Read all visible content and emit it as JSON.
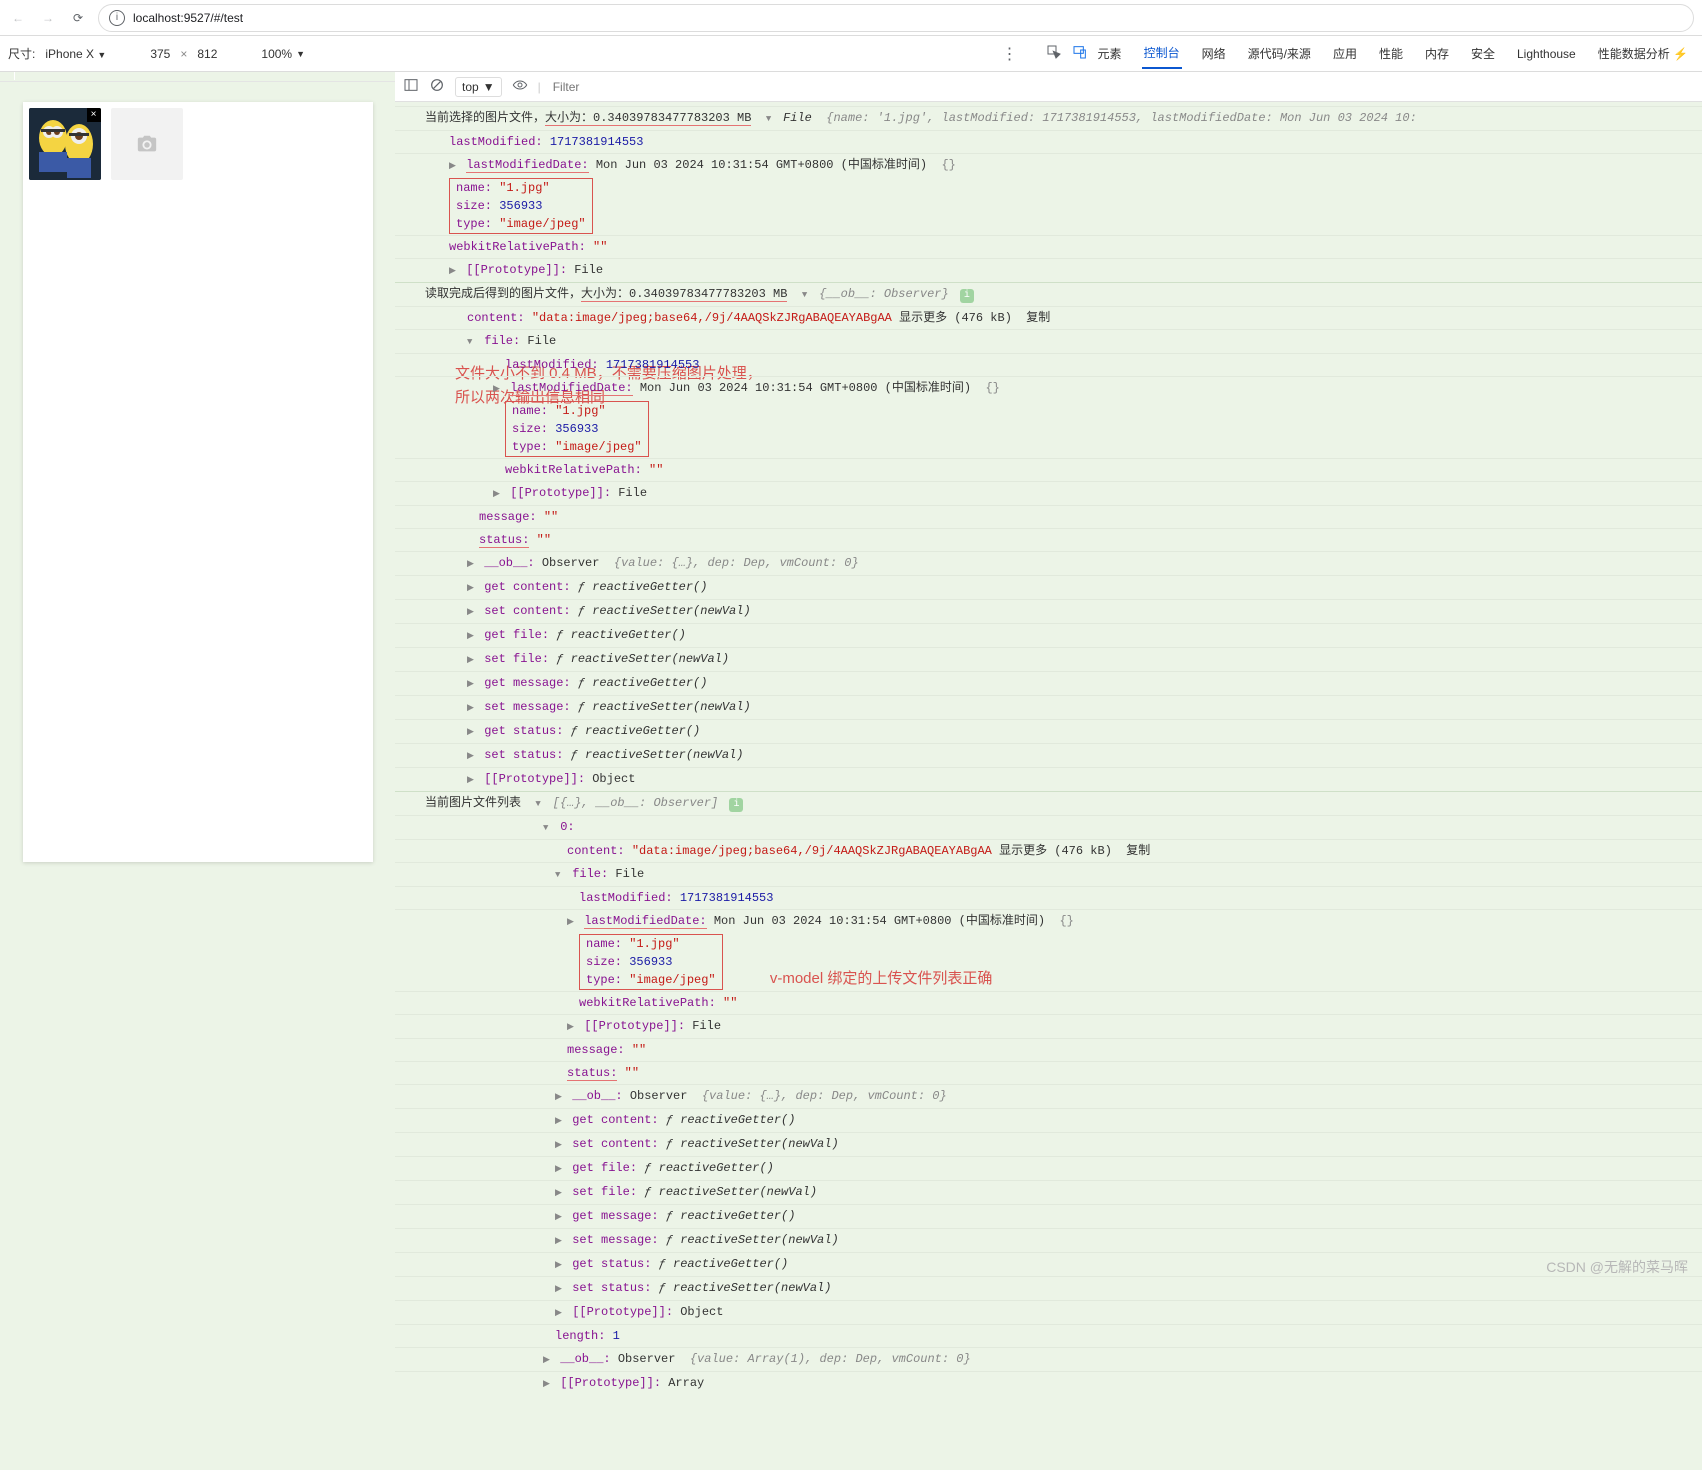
{
  "browser": {
    "url": "localhost:9527/#/test",
    "back_enabled": false,
    "forward_enabled": false
  },
  "device_toolbar": {
    "label": "尺寸:",
    "device": "iPhone X",
    "width": "375",
    "sep": "×",
    "height": "812",
    "zoom": "100%"
  },
  "devtools_tabs": {
    "elements": "元素",
    "console": "控制台",
    "network": "网络",
    "sources": "源代码/来源",
    "application": "应用",
    "performance": "性能",
    "memory": "内存",
    "security": "安全",
    "lighthouse": "Lighthouse",
    "perf_insights": "性能数据分析 ⚡"
  },
  "console_bar": {
    "context": "top",
    "filter_placeholder": "Filter"
  },
  "annotations": {
    "a1": "文件大小不到 0.4 MB，不需要压缩图片处理，所以两次输出信息相同",
    "a2": "v-model 绑定的上传文件列表正确"
  },
  "log1": {
    "prefix": "当前选择的图片文件，",
    "size_label": "大小为：0.34039783477783203 MB",
    "type": "File",
    "inline": "{name: '1.jpg', lastModified: 1717381914553, lastModifiedDate: Mon Jun 03 2024 10:",
    "lastModified_k": "lastModified:",
    "lastModified_v": "1717381914553",
    "lmd_k": "lastModifiedDate:",
    "lmd_v": "Mon Jun 03 2024 10:31:54 GMT+0800 (中国标准时间)",
    "lmd_tail": "{}",
    "name_k": "name:",
    "name_v": "\"1.jpg\"",
    "size_k": "size:",
    "size_v": "356933",
    "type_k": "type:",
    "type_v": "\"image/jpeg\"",
    "wrp_k": "webkitRelativePath:",
    "wrp_v": "\"\"",
    "proto_k": "[[Prototype]]:",
    "proto_v": "File"
  },
  "log2": {
    "prefix": "读取完成后得到的图片文件，",
    "size_label": "大小为：0.34039783477783203 MB",
    "obj": "{__ob__: Observer}",
    "content_k": "content:",
    "content_v": "\"data:image/jpeg;base64,/9j/4AAQSkZJRgABAQEAYABgAA",
    "content_more": "显示更多 (476 kB)",
    "content_copy": "复制",
    "file_k": "file:",
    "file_v": "File",
    "lastModified_k": "lastModified:",
    "lastModified_v": "1717381914553",
    "lmd_k": "lastModifiedDate:",
    "lmd_v": "Mon Jun 03 2024 10:31:54 GMT+0800 (中国标准时间)",
    "lmd_tail": "{}",
    "name_k": "name:",
    "name_v": "\"1.jpg\"",
    "size_k": "size:",
    "size_v": "356933",
    "type_k": "type:",
    "type_v": "\"image/jpeg\"",
    "wrp_k": "webkitRelativePath:",
    "wrp_v": "\"\"",
    "proto_k": "[[Prototype]]:",
    "proto_v": "File",
    "message_k": "message:",
    "message_v": "\"\"",
    "status_k": "status:",
    "status_v": "\"\"",
    "ob_k": "__ob__:",
    "ob_v": "Observer",
    "ob_detail": "{value: {…}, dep: Dep, vmCount: 0}",
    "get_content": "get content: ƒ reactiveGetter()",
    "set_content": "set content: ƒ reactiveSetter(newVal)",
    "get_file": "get file: ƒ reactiveGetter()",
    "set_file": "set file: ƒ reactiveSetter(newVal)",
    "get_message": "get message: ƒ reactiveGetter()",
    "set_message": "set message: ƒ reactiveSetter(newVal)",
    "get_status": "get status: ƒ reactiveGetter()",
    "set_status": "set status: ƒ reactiveSetter(newVal)",
    "proto2_k": "[[Prototype]]:",
    "proto2_v": "Object"
  },
  "log3": {
    "prefix": "当前图片文件列表",
    "head": "[{…}, __ob__: Observer]",
    "idx": "0:",
    "content_k": "content:",
    "content_v": "\"data:image/jpeg;base64,/9j/4AAQSkZJRgABAQEAYABgAA",
    "content_more": "显示更多 (476 kB)",
    "content_copy": "复制",
    "file_k": "file:",
    "file_v": "File",
    "lastModified_k": "lastModified:",
    "lastModified_v": "1717381914553",
    "lmd_k": "lastModifiedDate:",
    "lmd_v": "Mon Jun 03 2024 10:31:54 GMT+0800 (中国标准时间)",
    "lmd_tail": "{}",
    "name_k": "name:",
    "name_v": "\"1.jpg\"",
    "size_k": "size:",
    "size_v": "356933",
    "type_k": "type:",
    "type_v": "\"image/jpeg\"",
    "wrp_k": "webkitRelativePath:",
    "wrp_v": "\"\"",
    "proto_k": "[[Prototype]]:",
    "proto_v": "File",
    "message_k": "message:",
    "message_v": "\"\"",
    "status_k": "status:",
    "status_v": "\"\"",
    "ob_k": "__ob__:",
    "ob_v": "Observer",
    "ob_detail": "{value: {…}, dep: Dep, vmCount: 0}",
    "get_content": "get content: ƒ reactiveGetter()",
    "set_content": "set content: ƒ reactiveSetter(newVal)",
    "get_file": "get file: ƒ reactiveGetter()",
    "set_file": "set file: ƒ reactiveSetter(newVal)",
    "get_message": "get message: ƒ reactiveGetter()",
    "set_message": "set message: ƒ reactiveSetter(newVal)",
    "get_status": "get status: ƒ reactiveGetter()",
    "set_status": "set status: ƒ reactiveSetter(newVal)",
    "proto2_k": "[[Prototype]]:",
    "proto2_v": "Object",
    "length_k": "length:",
    "length_v": "1",
    "ob2_k": "__ob__:",
    "ob2_v": "Observer",
    "ob2_detail": "{value: Array(1), dep: Dep, vmCount: 0}",
    "proto3_k": "[[Prototype]]:",
    "proto3_v": "Array"
  },
  "watermark": "CSDN @无解的菜马晖"
}
